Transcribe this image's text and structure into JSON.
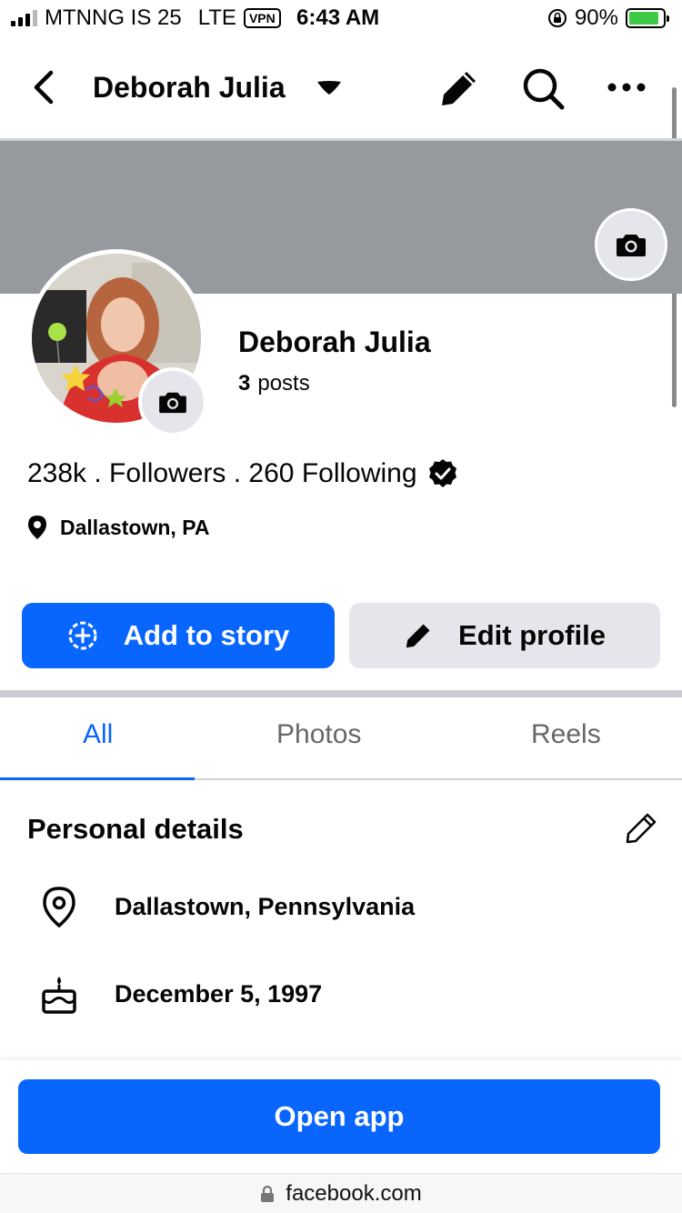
{
  "status_bar": {
    "carrier": "MTNNG IS 25",
    "network": "LTE",
    "vpn": "VPN",
    "time": "6:43 AM",
    "battery_percent": "90%",
    "battery_level": 0.9,
    "signal_bars": 3
  },
  "header": {
    "title": "Deborah Julia",
    "icons": [
      "back-icon",
      "caret-down-icon",
      "pencil-icon",
      "search-icon",
      "more-icon"
    ]
  },
  "profile": {
    "name": "Deborah Julia",
    "posts_count": "3",
    "posts_label": "posts",
    "follow_text": "238k . Followers . 260 Following",
    "location_short": "Dallastown, PA"
  },
  "actions": {
    "add_story": "Add to story",
    "edit_profile": "Edit profile"
  },
  "tabs": [
    {
      "label": "All",
      "active": true
    },
    {
      "label": "Photos",
      "active": false
    },
    {
      "label": "Reels",
      "active": false
    }
  ],
  "personal_details": {
    "title": "Personal details",
    "rows": [
      {
        "icon": "location-pin-icon",
        "text": "Dallastown, Pennsylvania"
      },
      {
        "icon": "birthday-cake-icon",
        "text": "December 5, 1997"
      }
    ]
  },
  "bottom": {
    "open_app": "Open app",
    "url": "facebook.com"
  },
  "colors": {
    "brand_blue": "#0866ff",
    "secondary_button": "#e4e6eb",
    "cover_gray": "#969a9f"
  }
}
